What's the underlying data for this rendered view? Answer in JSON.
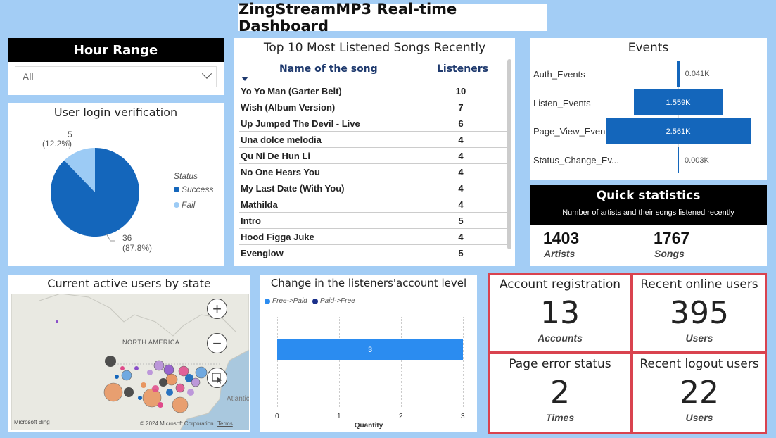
{
  "header": {
    "title": "ZingStreamMP3 Real-time Dashboard"
  },
  "hour_range": {
    "title": "Hour Range",
    "selected": "All"
  },
  "login": {
    "title": "User login verification",
    "legend_title": "Status",
    "legend": [
      {
        "label": "Success",
        "color": "#1466bb"
      },
      {
        "label": "Fail",
        "color": "#9ccbf5"
      }
    ],
    "fail_label": "5",
    "fail_pct": "(12.2%)",
    "success_label": "36",
    "success_pct": "(87.8%)",
    "chart_data": {
      "type": "pie",
      "categories": [
        "Success",
        "Fail"
      ],
      "values": [
        36,
        5
      ],
      "title": "User login verification"
    }
  },
  "songs": {
    "title": "Top 10 Most Listened Songs Recently",
    "col_name": "Name of the song",
    "col_listeners": "Listeners",
    "rows": [
      {
        "name": "Yo Yo Man (Garter Belt)",
        "count": "10"
      },
      {
        "name": "Wish (Album Version)",
        "count": "7"
      },
      {
        "name": "Up Jumped The Devil - Live",
        "count": "6"
      },
      {
        "name": "Una dolce melodia",
        "count": "4"
      },
      {
        "name": "Qu Ni De Hun Li",
        "count": "4"
      },
      {
        "name": "No One Hears You",
        "count": "4"
      },
      {
        "name": "My Last Date (With You)",
        "count": "4"
      },
      {
        "name": "Mathilda",
        "count": "4"
      },
      {
        "name": "Intro",
        "count": "5"
      },
      {
        "name": "Hood Figga Juke",
        "count": "4"
      },
      {
        "name": "Evenglow",
        "count": "5"
      }
    ]
  },
  "events": {
    "title": "Events",
    "items": [
      {
        "label": "Auth_Events",
        "value_label": "0.041K"
      },
      {
        "label": "Listen_Events",
        "value_label": "1.559K"
      },
      {
        "label": "Page_View_Events",
        "value_label": "2.561K"
      },
      {
        "label": "Status_Change_Ev...",
        "value_label": "0.003K"
      }
    ],
    "chart_data": {
      "type": "bar",
      "categories": [
        "Auth_Events",
        "Listen_Events",
        "Page_View_Events",
        "Status_Change_Events"
      ],
      "values": [
        41,
        1559,
        2561,
        3
      ],
      "title": "Events"
    }
  },
  "quick": {
    "title": "Quick statistics",
    "subtitle": "Number of artists and their songs listened recently",
    "artists_value": "1403",
    "artists_label": "Artists",
    "songs_value": "1767",
    "songs_label": "Songs"
  },
  "map": {
    "title": "Current active users by state",
    "region_label": "NORTH AMERICA",
    "ocean_label": "Atlantic",
    "copyright": "© 2024 Microsoft Corporation",
    "terms": "Terms",
    "brand": "Microsoft Bing",
    "zoom_in": "+",
    "zoom_out": "−"
  },
  "account_level": {
    "title": "Change in the listeners'account level",
    "legend": [
      {
        "label": "Free->Paid",
        "color": "#2b8cf0"
      },
      {
        "label": "Paid->Free",
        "color": "#1a2f8a"
      }
    ],
    "bar_label": "3",
    "x_label": "Quantity",
    "ticks": [
      "0",
      "1",
      "2",
      "3"
    ],
    "chart_data": {
      "type": "bar",
      "orientation": "horizontal",
      "series": [
        {
          "name": "Free->Paid",
          "values": [
            3
          ]
        },
        {
          "name": "Paid->Free",
          "values": [
            0
          ]
        }
      ],
      "xlabel": "Quantity",
      "xlim": [
        0,
        3
      ]
    }
  },
  "kpis": {
    "registration": {
      "title": "Account registration",
      "value": "13",
      "label": "Accounts"
    },
    "online": {
      "title": "Recent online users",
      "value": "395",
      "label": "Users"
    },
    "errors": {
      "title": "Page error status",
      "value": "2",
      "label": "Times"
    },
    "logout": {
      "title": "Recent logout users",
      "value": "22",
      "label": "Users"
    }
  }
}
